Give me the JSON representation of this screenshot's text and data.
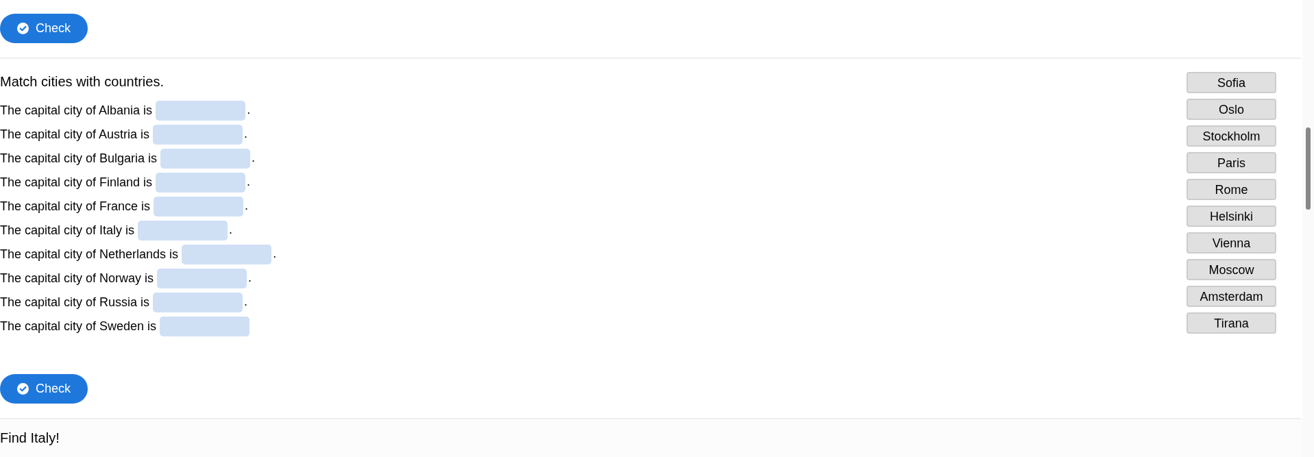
{
  "check_buttons": [
    {
      "label": "Check"
    },
    {
      "label": "Check"
    }
  ],
  "exercise": {
    "instruction": "Match cities with countries.",
    "sentences": [
      {
        "text": "The capital city of Albania is",
        "end": "."
      },
      {
        "text": "The capital city of Austria is",
        "end": "."
      },
      {
        "text": "The capital city of Bulgaria is",
        "end": "."
      },
      {
        "text": "The capital city of Finland is",
        "end": "."
      },
      {
        "text": "The capital city of France is",
        "end": "."
      },
      {
        "text": "The capital city of Italy is",
        "end": "."
      },
      {
        "text": "The capital city of Netherlands is",
        "end": "."
      },
      {
        "text": "The capital city of Norway is",
        "end": "."
      },
      {
        "text": "The capital city of Russia is",
        "end": "."
      },
      {
        "text": "The capital city of Sweden is"
      }
    ],
    "word_bank": [
      "Sofia",
      "Oslo",
      "Stockholm",
      "Paris",
      "Rome",
      "Helsinki",
      "Vienna",
      "Moscow",
      "Amsterdam",
      "Tirana"
    ]
  },
  "next_exercise": {
    "instruction": "Find Italy!"
  }
}
